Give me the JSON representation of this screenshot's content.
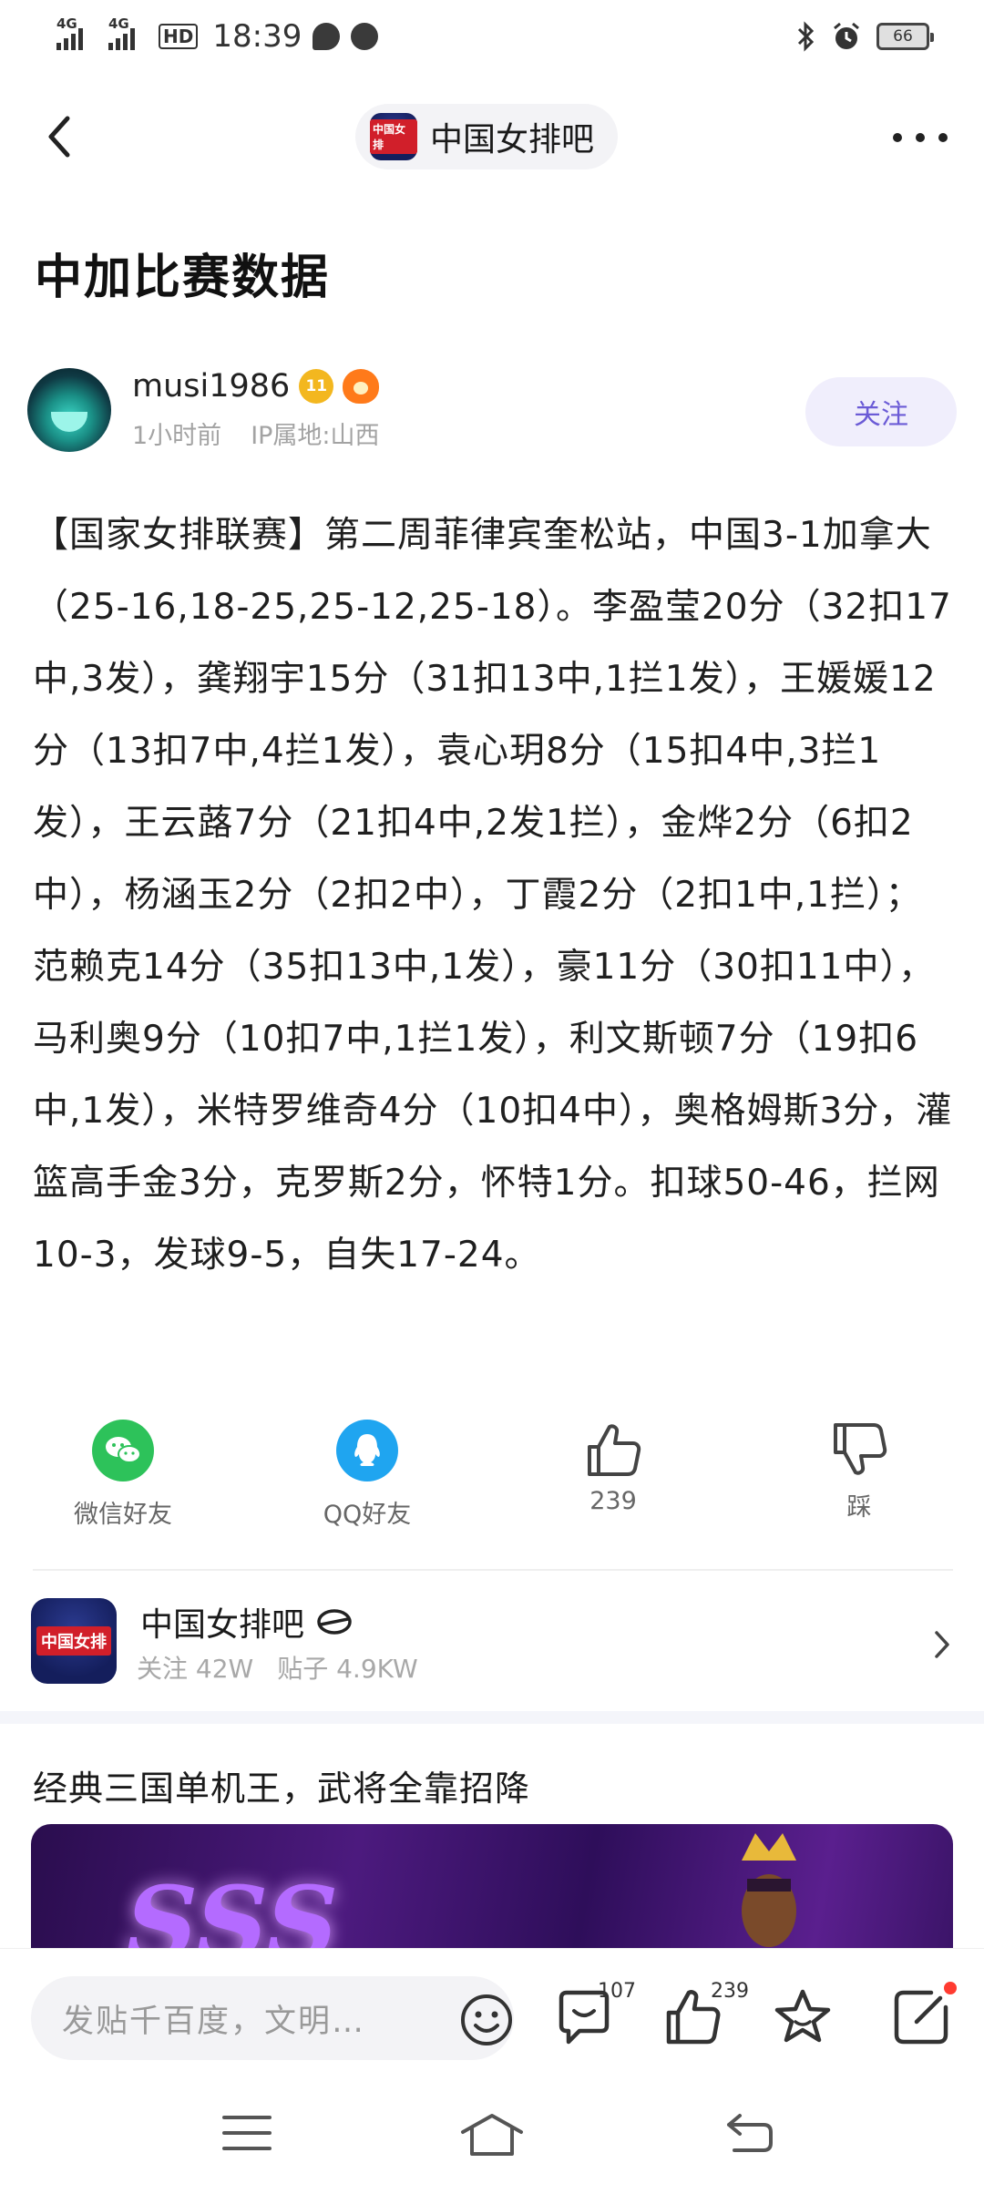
{
  "status_bar": {
    "network1": "4G",
    "network2": "4G",
    "hd_label": "HD",
    "time": "18:39",
    "battery": "66"
  },
  "nav": {
    "forum_name": "中国女排吧",
    "forum_logo_text": "中国女排"
  },
  "post": {
    "title": "中加比赛数据",
    "author": {
      "name": "musi1986",
      "level": "11",
      "time_ago": "1小时前",
      "ip_location": "IP属地:山西",
      "follow_label": "关注"
    },
    "body": "【国家女排联赛】第二周菲律宾奎松站，中国3-1加拿大（25-16,18-25,25-12,25-18）。李盈莹20分（32扣17中,3发），龚翔宇15分（31扣13中,1拦1发），王媛媛12分（13扣7中,4拦1发），袁心玥8分（15扣4中,3拦1发），王云蕗7分（21扣4中,2发1拦），金烨2分（6扣2中），杨涵玉2分（2扣2中），丁霞2分（2扣1中,1拦）；范赖克14分（35扣13中,1发），豪11分（30扣11中），马利奥9分（10扣7中,1拦1发），利文斯顿7分（19扣6中,1发），米特罗维奇4分（10扣4中），奥格姆斯3分，灌篮高手金3分，克罗斯2分，怀特1分。扣球50-46，拦网10-3，发球9-5，自失17-24。"
  },
  "share": {
    "wechat_label": "微信好友",
    "qq_label": "QQ好友",
    "like_count": "239",
    "dislike_label": "踩",
    "wechat_color": "#2dc25a",
    "qq_color": "#1fa5f0"
  },
  "forum_card": {
    "name": "中国女排吧",
    "followers": "关注 42W",
    "posts": "贴子 4.9KW"
  },
  "ad": {
    "title": "经典三国单机王，武将全靠招降",
    "image_text": "SSS"
  },
  "bottom_bar": {
    "reply_placeholder": "发贴千百度，文明…",
    "comment_count": "107",
    "like_count": "239",
    "accent_color": "#ff3b30"
  }
}
